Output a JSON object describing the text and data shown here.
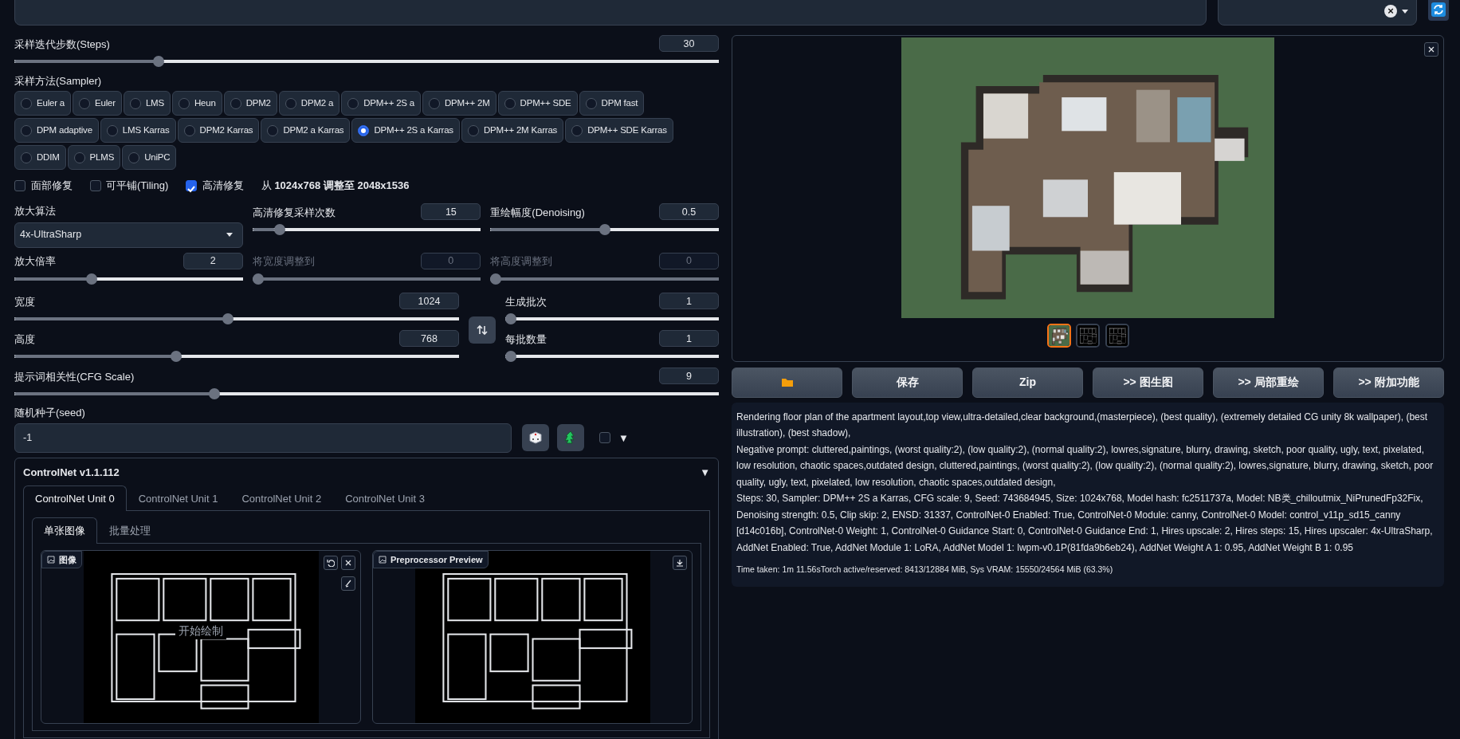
{
  "top": {
    "style_clear": "×"
  },
  "steps": {
    "label": "采样迭代步数(Steps)",
    "value": "30",
    "level": 0.2
  },
  "sampler": {
    "label": "采样方法(Sampler)",
    "options": [
      {
        "label": "Euler a",
        "selected": false
      },
      {
        "label": "Euler",
        "selected": false
      },
      {
        "label": "LMS",
        "selected": false
      },
      {
        "label": "Heun",
        "selected": false
      },
      {
        "label": "DPM2",
        "selected": false
      },
      {
        "label": "DPM2 a",
        "selected": false
      },
      {
        "label": "DPM++ 2S a",
        "selected": false
      },
      {
        "label": "DPM++ 2M",
        "selected": false
      },
      {
        "label": "DPM++ SDE",
        "selected": false
      },
      {
        "label": "DPM fast",
        "selected": false
      },
      {
        "label": "DPM adaptive",
        "selected": false
      },
      {
        "label": "LMS Karras",
        "selected": false
      },
      {
        "label": "DPM2 Karras",
        "selected": false
      },
      {
        "label": "DPM2 a Karras",
        "selected": false
      },
      {
        "label": "DPM++ 2S a Karras",
        "selected": true
      },
      {
        "label": "DPM++ 2M Karras",
        "selected": false
      },
      {
        "label": "DPM++ SDE Karras",
        "selected": false
      },
      {
        "label": "DDIM",
        "selected": false
      },
      {
        "label": "PLMS",
        "selected": false
      },
      {
        "label": "UniPC",
        "selected": false
      }
    ]
  },
  "toggles": [
    {
      "label": "面部修复",
      "checked": false
    },
    {
      "label": "可平铺(Tiling)",
      "checked": false
    },
    {
      "label": "高清修复",
      "checked": true
    }
  ],
  "resize_note": "从 **1024x768 调整至 2048x1536**",
  "upscaler": {
    "label": "放大算法",
    "value": "4x-UltraSharp"
  },
  "hires_sliders": [
    {
      "label": "高清修复采样次数",
      "value": "15",
      "level": 0.1,
      "disabled": false
    },
    {
      "label": "重绘幅度(Denoising)",
      "value": "0.5",
      "level": 0.5,
      "disabled": false
    },
    {
      "label": "放大倍率",
      "value": "2",
      "level": 0.33,
      "disabled": false
    },
    {
      "label": "将宽度调整到",
      "value": "0",
      "level": 0,
      "disabled": true
    },
    {
      "label": "将高度调整到",
      "value": "0",
      "level": 0,
      "disabled": true
    }
  ],
  "size_sliders": [
    {
      "label": "宽度",
      "value": "1024",
      "level": 0.48,
      "disabled": false
    },
    {
      "label": "高度",
      "value": "768",
      "level": 0.36,
      "disabled": false
    }
  ],
  "batch_sliders": [
    {
      "label": "生成批次",
      "value": "1",
      "level": 0,
      "disabled": false
    },
    {
      "label": "每批数量",
      "value": "1",
      "level": 0,
      "disabled": false
    }
  ],
  "cfg": {
    "label": "提示词相关性(CFG Scale)",
    "value": "9",
    "level": 0.28,
    "disabled": false
  },
  "seed": {
    "label": "随机种子(seed)",
    "value": "-1",
    "extra_checked": false,
    "toggle": "▼"
  },
  "controlnet": {
    "title": "ControlNet v1.1.112",
    "toggle": "▼",
    "tabs": [
      {
        "label": "ControlNet Unit 0",
        "selected": true
      },
      {
        "label": "ControlNet Unit 1",
        "selected": false
      },
      {
        "label": "ControlNet Unit 2",
        "selected": false
      },
      {
        "label": "ControlNet Unit 3",
        "selected": false
      }
    ],
    "subtabs": [
      {
        "label": "单张图像",
        "selected": true
      },
      {
        "label": "批量处理",
        "selected": false
      }
    ],
    "image_label": "图像",
    "canvas_hint": "开始绘制",
    "preview_label": "Preprocessor Preview"
  },
  "gallery": {
    "thumbnails": [
      {
        "selected": true,
        "kind": "render"
      },
      {
        "selected": false,
        "kind": "lines"
      },
      {
        "selected": false,
        "kind": "lines"
      }
    ]
  },
  "actions": [
    {
      "kind": "folder"
    },
    {
      "label": "保存"
    },
    {
      "label": "Zip"
    },
    {
      "label": ">> 图生图"
    },
    {
      "label": ">> 局部重绘"
    },
    {
      "label": ">> 附加功能"
    }
  ],
  "info": [
    "Rendering floor plan of the apartment layout,top view,ultra-detailed,clear background,(masterpiece), (best quality), (extremely detailed CG unity 8k wallpaper), (best illustration), (best shadow),",
    "Negative prompt: cluttered,paintings, (worst quality:2), (low quality:2), (normal quality:2), lowres,signature, blurry, drawing, sketch, poor quality, ugly, text, pixelated, low resolution, chaotic spaces,outdated design, cluttered,paintings, (worst quality:2), (low quality:2), (normal quality:2), lowres,signature, blurry, drawing, sketch, poor quality, ugly, text, pixelated, low resolution, chaotic spaces,outdated design,",
    "Steps: 30, Sampler: DPM++ 2S a Karras, CFG scale: 9, Seed: 743684945, Size: 1024x768, Model hash: fc2511737a, Model: NB类_chilloutmix_NiPrunedFp32Fix, Denoising strength: 0.5, Clip skip: 2, ENSD: 31337, ControlNet-0 Enabled: True, ControlNet-0 Module: canny, ControlNet-0 Model: control_v11p_sd15_canny [d14c016b], ControlNet-0 Weight: 1, ControlNet-0 Guidance Start: 0, ControlNet-0 Guidance End: 1, Hires upscale: 2, Hires steps: 15, Hires upscaler: 4x-UltraSharp, AddNet Enabled: True, AddNet Module 1: LoRA, AddNet Model 1: lwpm-v0.1P(81fda9b6eb24), AddNet Weight A 1: 0.95, AddNet Weight B 1: 0.95"
  ],
  "time_taken": "Time taken: 1m 11.56sTorch active/reserved: 8413/12884 MiB, Sys VRAM: 15550/24564 MiB (63.3%)"
}
